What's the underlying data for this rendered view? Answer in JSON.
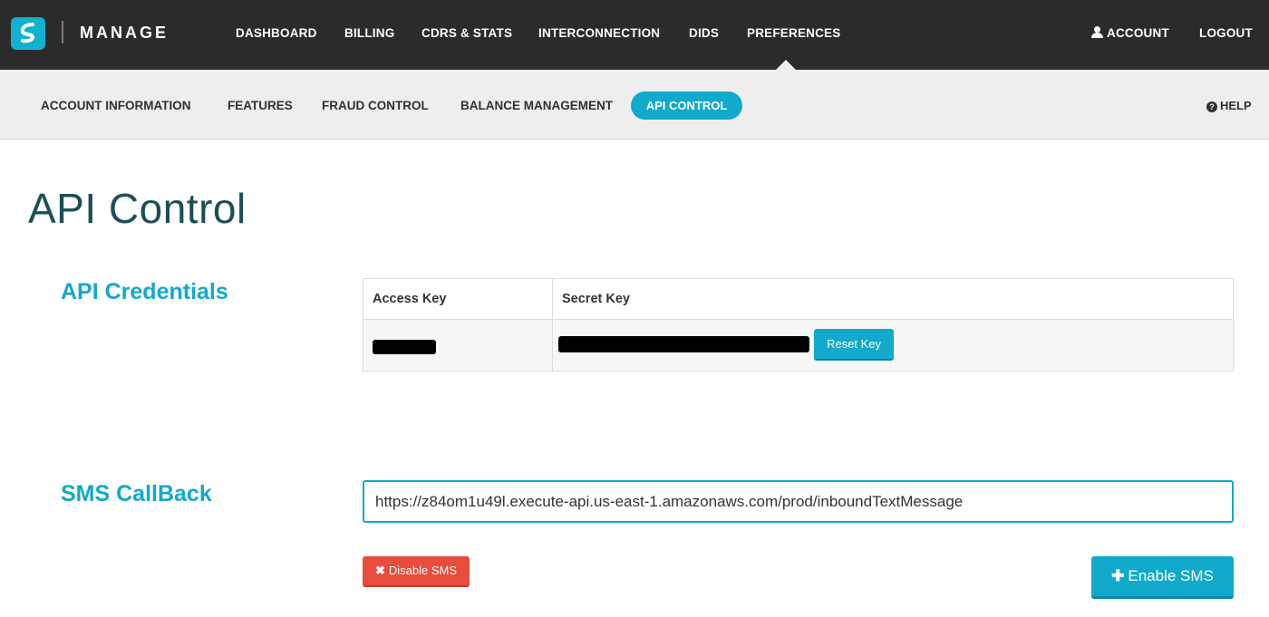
{
  "header": {
    "brand": "MANAGE",
    "nav": [
      {
        "label": "DASHBOARD"
      },
      {
        "label": "BILLING"
      },
      {
        "label": "CDRS & STATS"
      },
      {
        "label": "INTERCONNECTION"
      },
      {
        "label": "DIDS"
      },
      {
        "label": "PREFERENCES"
      }
    ],
    "account_label": "ACCOUNT",
    "logout_label": "LOGOUT"
  },
  "subnav": {
    "items": [
      {
        "label": "ACCOUNT INFORMATION"
      },
      {
        "label": "FEATURES"
      },
      {
        "label": "FRAUD CONTROL"
      },
      {
        "label": "BALANCE MANAGEMENT"
      },
      {
        "label": "API CONTROL"
      }
    ],
    "active_index": 4,
    "help_label": "HELP"
  },
  "page": {
    "title": "API Control"
  },
  "credentials": {
    "section_label": "API Credentials",
    "columns": [
      "Access Key",
      "Secret Key"
    ],
    "reset_label": "Reset Key"
  },
  "sms": {
    "section_label": "SMS CallBack",
    "callback_url": "https://z84om1u49l.execute-api.us-east-1.amazonaws.com/prod/inboundTextMessage",
    "disable_label": "Disable SMS",
    "enable_label": "Enable SMS"
  },
  "colors": {
    "accent": "#11a9cc",
    "topbar": "#2b2b2b",
    "subbar": "#eeeeee",
    "danger": "#e74c3c",
    "title": "#1d4e56"
  },
  "icons": {
    "logo": "brand-logo-icon",
    "account": "user-icon",
    "help": "question-circle-icon",
    "disable": "times-icon",
    "enable": "plus-icon"
  }
}
